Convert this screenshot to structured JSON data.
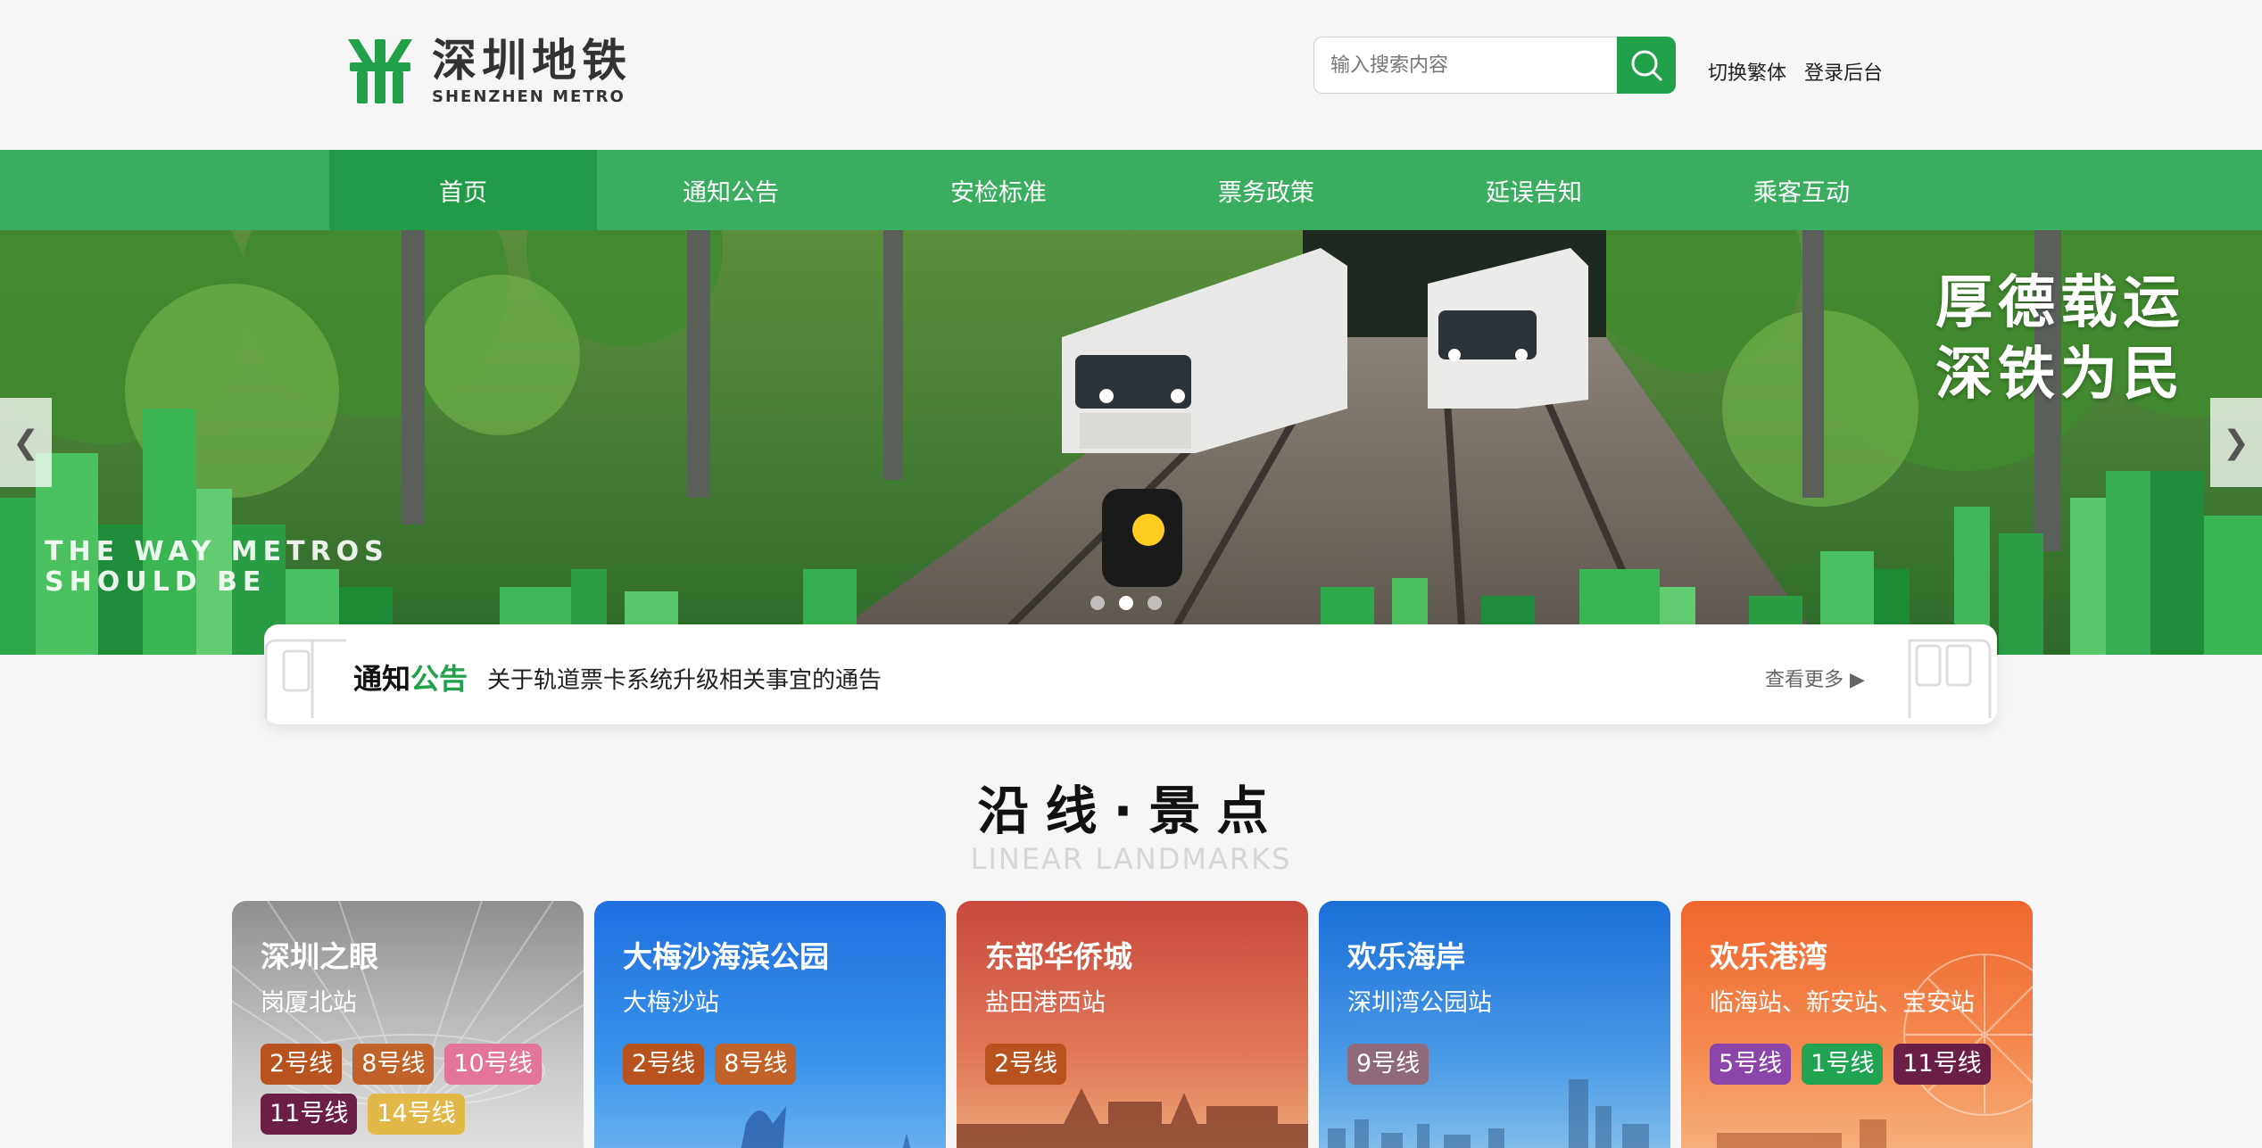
{
  "header": {
    "logo_cn": "深圳地铁",
    "logo_en": "SHENZHEN METRO",
    "search_placeholder": "输入搜索内容",
    "switch_label": "切换繁体",
    "login_label": "登录后台"
  },
  "nav": {
    "items": [
      "首页",
      "通知公告",
      "安检标准",
      "票务政策",
      "延误告知",
      "乘客互动"
    ],
    "active": "首页"
  },
  "banner": {
    "slogan_line1": "厚德载运",
    "slogan_line2": "深铁为民",
    "en_line1": "THE WAY METROS",
    "en_line2": "SHOULD BE",
    "prev_label": "❮",
    "next_label": "❯",
    "slides": 3,
    "active_slide": 2
  },
  "notice": {
    "title_part1": "通知",
    "title_part2": "公告",
    "text": "关于轨道票卡系统升级相关事宜的通告",
    "more_label": "查看更多 ▶"
  },
  "section": {
    "title": "沿线·景点",
    "subtitle": "LINEAR LANDMARKS"
  },
  "cards": [
    {
      "name": "深圳之眼",
      "station": "岗厦北站",
      "tags": [
        {
          "label": "2号线",
          "color": "#b8531f"
        },
        {
          "label": "8号线",
          "color": "#c0622a"
        },
        {
          "label": "10号线",
          "color": "#e3749a"
        },
        {
          "label": "11号线",
          "color": "#6b1f47"
        },
        {
          "label": "14号线",
          "color": "#e2b948"
        }
      ]
    },
    {
      "name": "大梅沙海滨公园",
      "station": "大梅沙站",
      "tags": [
        {
          "label": "2号线",
          "color": "#b8531f"
        },
        {
          "label": "8号线",
          "color": "#c0622a"
        }
      ]
    },
    {
      "name": "东部华侨城",
      "station": "盐田港西站",
      "tags": [
        {
          "label": "2号线",
          "color": "#b8531f"
        }
      ]
    },
    {
      "name": "欢乐海岸",
      "station": "深圳湾公园站",
      "tags": [
        {
          "label": "9号线",
          "color": "#8f6a7a"
        }
      ]
    },
    {
      "name": "欢乐港湾",
      "station": "临海站、新安站、宝安站",
      "tags": [
        {
          "label": "5号线",
          "color": "#8c45a8"
        },
        {
          "label": "1号线",
          "color": "#21a352"
        },
        {
          "label": "11号线",
          "color": "#6b1f47"
        }
      ]
    }
  ],
  "colors": {
    "brand_green": "#22a04a",
    "nav_green": "#3aae5e",
    "nav_active": "#229a48"
  }
}
